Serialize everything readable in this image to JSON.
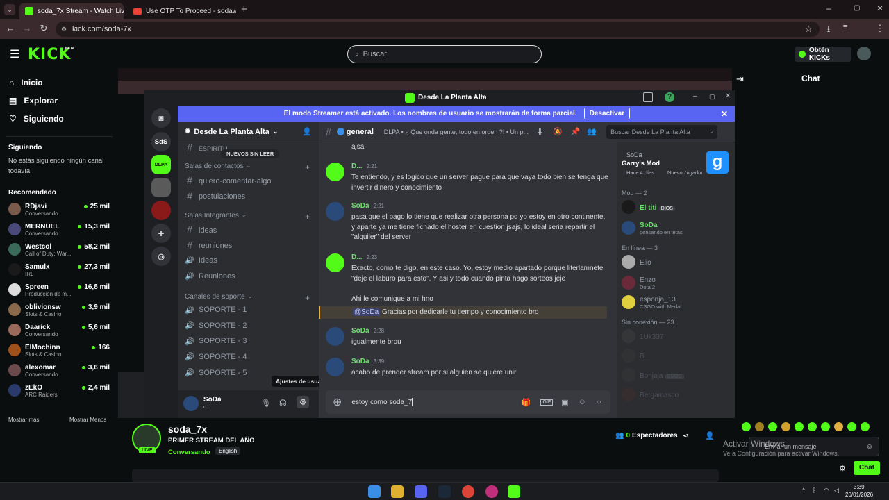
{
  "browser": {
    "tabs": [
      {
        "title": "soda_7x Stream - Watch Live o",
        "active": true
      },
      {
        "title": "Use OTP To Proceed - sodawar",
        "active": false
      }
    ],
    "url": "kick.com/soda-7x",
    "profile_initial": "S"
  },
  "kick": {
    "logo": "KICK",
    "beta": "BETA",
    "search_placeholder": "Buscar",
    "get_kicks": "Obtén KICKs",
    "nav": [
      {
        "label": "Inicio",
        "icon": "home-icon"
      },
      {
        "label": "Explorar",
        "icon": "compass-icon"
      },
      {
        "label": "Siguiendo",
        "icon": "heart-icon"
      }
    ],
    "following_title": "Siguiendo",
    "following_empty": "No estás siguiendo ningún canal todavía.",
    "recommended_title": "Recomendado",
    "recommended": [
      {
        "name": "RDjavi",
        "category": "Conversando",
        "viewers": "25 mil",
        "color": "#7a5a4a"
      },
      {
        "name": "MERNUEL",
        "category": "Conversando",
        "viewers": "15,3 mil",
        "color": "#4a4a7a"
      },
      {
        "name": "Westcol",
        "category": "Call of Duty: War...",
        "viewers": "58,2 mil",
        "color": "#3a6a5a"
      },
      {
        "name": "Samulx",
        "category": "IRL",
        "viewers": "27,3 mil",
        "color": "#1a1a1a"
      },
      {
        "name": "Spreen",
        "category": "Producción de m...",
        "viewers": "16,8 mil",
        "color": "#ddd"
      },
      {
        "name": "oblivionsw",
        "category": "Slots & Casino",
        "viewers": "3,9 mil",
        "color": "#8a6a4a"
      },
      {
        "name": "Daarick",
        "category": "Conversando",
        "viewers": "5,6 mil",
        "color": "#9a6a5a"
      },
      {
        "name": "ElMochinn",
        "category": "Slots & Casino",
        "viewers": "166",
        "color": "#a0501a"
      },
      {
        "name": "alexomar",
        "category": "Conversando",
        "viewers": "3,6 mil",
        "color": "#6a4a4a"
      },
      {
        "name": "zEkO",
        "category": "ARC Raiders",
        "viewers": "2,4 mil",
        "color": "#2a3a6a"
      }
    ],
    "show_more": "Mostrar más",
    "show_less": "Mostrar Menos",
    "chat_title": "Chat",
    "stream": {
      "channel": "soda_7x",
      "title": "PRIMER STREAM DEL AÑO",
      "category": "Conversando",
      "language": "English",
      "live": "LIVE",
      "viewers_count": "0",
      "viewers_label": "Espectadores"
    },
    "chat_input_placeholder": "Enviar un mensaje",
    "chat_send": "Chat",
    "windows_activation_title": "Activar Windows",
    "windows_activation_sub": "Ve a Configuración para activar Windows."
  },
  "discord": {
    "window_title": "Desde La Planta Alta",
    "streamer_banner": "El modo Streamer está activado. Los nombres de usuario se mostrarán de forma parcial.",
    "disable_button": "Desactivar",
    "server_name": "Desde La Planta Alta",
    "new_unread": "NUEVOS SIN LEER",
    "partial_channel": "ESPIRITU",
    "categories": [
      {
        "name": "Salas de contactos",
        "channels": [
          "quiero-comentar-algo",
          "postulaciones"
        ]
      },
      {
        "name": "Salas Integrantes",
        "channels": [
          "ideas",
          "reuniones",
          "Ideas",
          "Reuniones"
        ]
      },
      {
        "name": "Canales de soporte",
        "channels": [
          "SOPORTE - 1",
          "SOPORTE - 2",
          "SOPORTE - 3",
          "SOPORTE - 4",
          "SOPORTE - 5"
        ]
      }
    ],
    "channel_name": "general",
    "channel_topic": "DLPA • ¿ Que onda gente, todo en orden ?! • Un p...",
    "search_placeholder": "Buscar Desde La Planta Alta",
    "messages": [
      {
        "author": "",
        "time": "",
        "lines": [
          "ajsa"
        ]
      },
      {
        "author": "D...",
        "time": "2:21",
        "lines": [
          "Te entiendo, y es logico que un server pague para que vaya todo bien se tenga que invertir dinero y conocimiento"
        ]
      },
      {
        "author": "SoDa",
        "time": "2:21",
        "lines": [
          "pasa que el pago lo tiene que realizar otra persona pq yo estoy en otro continente, y aparte ya me tiene fichado el hoster en cuestion jsajs, lo ideal seria repartir el \"alquiler\" del server"
        ]
      },
      {
        "author": "D...",
        "time": "2:23",
        "lines": [
          "Exacto, como te digo, en este caso. Yo, estoy medio apartado porque literlamnete \"deje el laburo para esto\". Y asi y todo cuando pinta hago sorteos jeje",
          "Ahi le comunique a mi hno"
        ]
      },
      {
        "author": "",
        "time": "",
        "mention": "@SoDa",
        "lines": [
          "Gracias por dedicarle tu tiempo y conocimiento bro"
        ]
      },
      {
        "author": "SoDa",
        "time": "2:28",
        "lines": [
          "igualmente brou"
        ]
      },
      {
        "author": "SoDa",
        "time": "3:39",
        "lines": [
          "acabo de prender stream por si alguien se quiere unir"
        ]
      }
    ],
    "input_text": "estoy como soda_7",
    "user_panel": {
      "name": "SoDa",
      "status": "c..."
    },
    "settings_tooltip": "Ajustes de usuario",
    "activity": {
      "user": "SoDa",
      "game": "Garry's Mod",
      "time": "Hace 4 días",
      "badge": "Nuevo Jugador"
    },
    "member_groups": [
      {
        "label": "Mod — 2",
        "members": [
          {
            "name": "El titi",
            "tag": "DIOS",
            "status": ""
          },
          {
            "name": "SoDa",
            "tag": "",
            "status": "pensando en tetas"
          }
        ]
      },
      {
        "label": "En línea — 3",
        "members": [
          {
            "name": "Elio",
            "tag": "",
            "status": ""
          },
          {
            "name": "Enzo",
            "tag": "",
            "status": "Dota 2"
          },
          {
            "name": "esponja_13",
            "tag": "",
            "status": "CSGO with Medal"
          }
        ]
      },
      {
        "label": "Sin conexión — 23",
        "members": [
          {
            "name": "1Uk337",
            "tag": "",
            "status": ""
          },
          {
            "name": "B...",
            "tag": "",
            "status": ""
          },
          {
            "name": "Bonjaja",
            "tag": "EMOD",
            "status": ""
          },
          {
            "name": "Bergamasco",
            "tag": "",
            "status": ""
          }
        ]
      }
    ]
  },
  "taskbar": {
    "time": "3:39",
    "date": "20/01/2026"
  }
}
